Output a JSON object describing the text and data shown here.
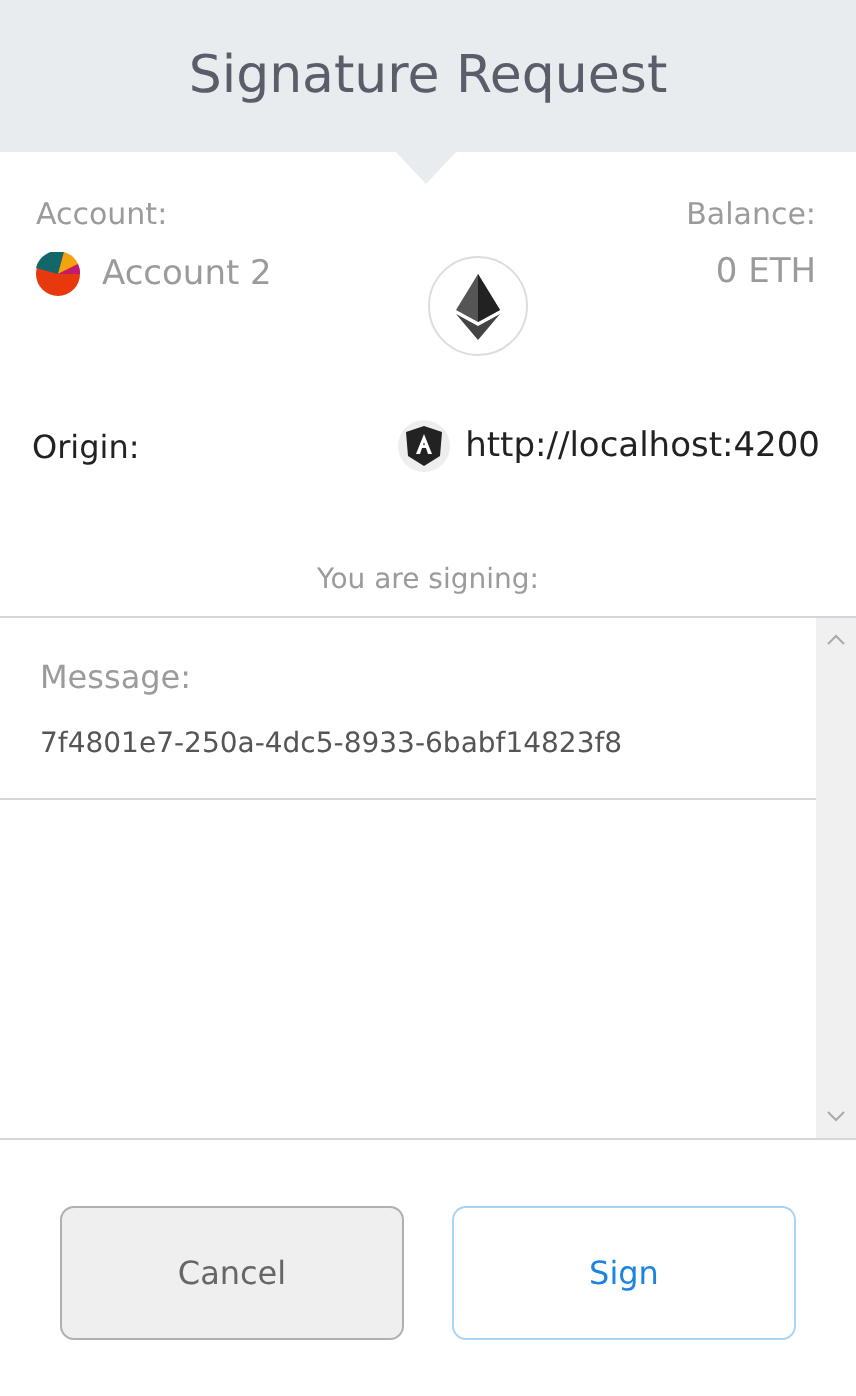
{
  "header": {
    "title": "Signature Request"
  },
  "account": {
    "label": "Account:",
    "name": "Account 2"
  },
  "balance": {
    "label": "Balance:",
    "value": "0 ETH"
  },
  "origin": {
    "label": "Origin:",
    "url": "http://localhost:4200"
  },
  "signing_label": "You are signing:",
  "message": {
    "label": "Message:",
    "value": "7f4801e7-250a-4dc5-8933-6babf14823f8"
  },
  "buttons": [
    {
      "label": "Cancel",
      "kind": "secondary"
    },
    {
      "label": "Sign",
      "kind": "primary"
    }
  ]
}
